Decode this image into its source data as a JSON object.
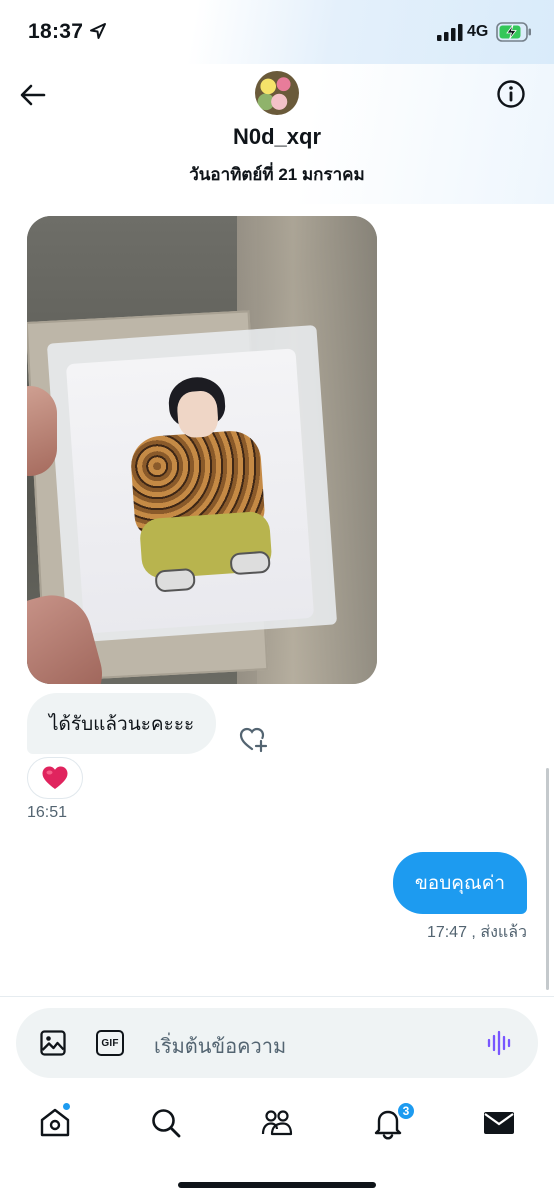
{
  "status_bar": {
    "time": "18:37",
    "network": "4G"
  },
  "header": {
    "username": "N0d_xqr",
    "date": "วันอาทิตย์ที่ 21 มกราคม"
  },
  "messages": {
    "incoming_text": "ได้รับแล้วนะคะะะ",
    "reaction_emoji": "❤️",
    "incoming_time": "16:51",
    "outgoing_text": "ขอบคุณค่า",
    "outgoing_status": "17:47 , ส่งแล้ว"
  },
  "composer": {
    "placeholder": "เริ่มต้นข้อความ",
    "gif_label": "GIF"
  },
  "nav": {
    "notifications_badge": "3"
  },
  "colors": {
    "accent": "#1d9bf0",
    "bubble_in": "#eff3f4",
    "text": "#0f1419",
    "muted": "#536471",
    "voice_icon": "#7856ff"
  },
  "icons": [
    "location-arrow-icon",
    "signal-icon",
    "battery-charging-icon",
    "back-arrow-icon",
    "info-icon",
    "heart-plus-icon",
    "image-icon",
    "gif-icon",
    "voice-waveform-icon",
    "home-icon",
    "search-icon",
    "communities-icon",
    "bell-icon",
    "mail-icon"
  ]
}
